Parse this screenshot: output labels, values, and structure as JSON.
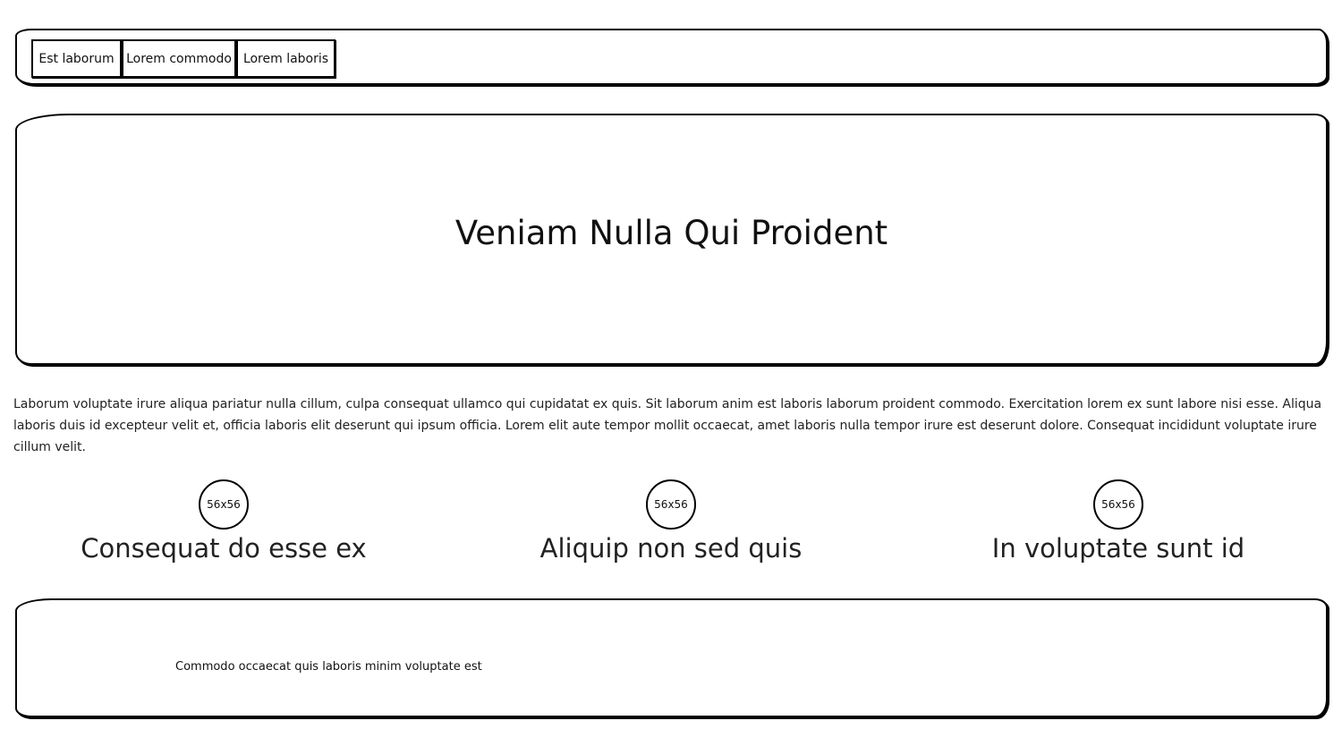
{
  "nav": {
    "items": [
      {
        "label": "Est laborum"
      },
      {
        "label": "Lorem commodo"
      },
      {
        "label": "Lorem laboris"
      }
    ]
  },
  "hero": {
    "title": "Veniam Nulla Qui Proident"
  },
  "intro": {
    "paragraph": "Laborum voluptate irure aliqua pariatur nulla cillum, culpa consequat ullamco qui cupidatat ex quis. Sit laborum anim est laboris laborum proident commodo. Exercitation lorem ex sunt labore nisi esse. Aliqua laboris duis id excepteur velit et, officia laboris elit deserunt qui ipsum officia. Lorem elit aute tempor mollit occaecat, amet laboris nulla tempor irure est deserunt dolore. Consequat incididunt voluptate irure cillum velit."
  },
  "features": [
    {
      "avatar_label": "56x56",
      "title": "Consequat do esse ex"
    },
    {
      "avatar_label": "56x56",
      "title": "Aliquip non sed quis"
    },
    {
      "avatar_label": "56x56",
      "title": "In voluptate sunt id"
    }
  ],
  "footer": {
    "text": "Commodo occaecat quis laboris minim voluptate est"
  }
}
